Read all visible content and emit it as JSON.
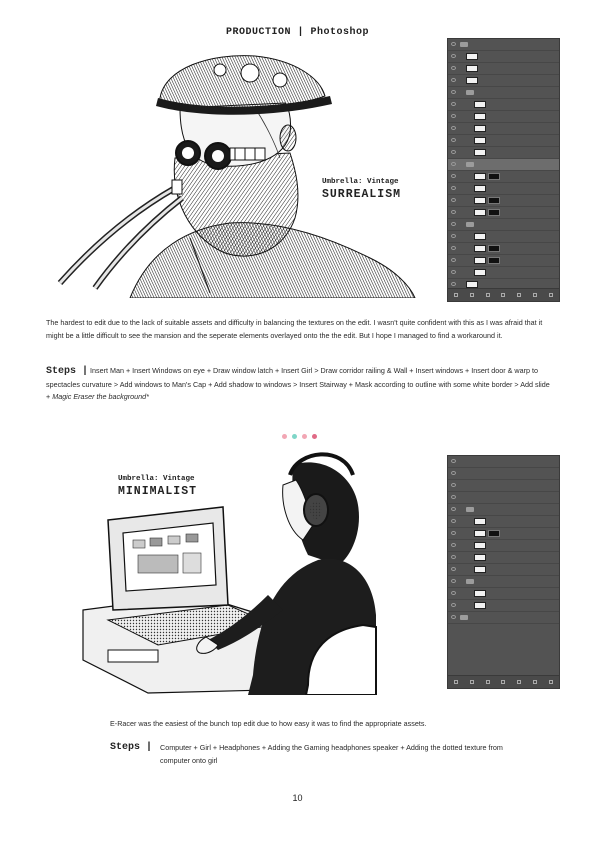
{
  "header": "PRODUCTION  |  Photoshop",
  "section1": {
    "umbrella_small": "Umbrella: Vintage",
    "umbrella_big": "SURREALISM",
    "description": "The hardest to edit due to the lack of suitable assets and difficulty in balancing the textures on the edit. I wasn't quite confident with this as I was afraid that it might be a little difficult to see the mansion and the seperate elements overlayed onto the the edit. But I hope I managed to find a workaround it.",
    "steps_label": "Steps  |",
    "steps_text": "Insert Man + Insert Windows on eye + Draw window latch + Insert Girl > Draw corridor railing & Wall + Insert windows + Insert door & warp to spectacles curvature > Add windows to Man's Cap + Add shadow to windows > Insert Stairway + Mask according to outline with some white border > Add slide + ",
    "steps_italic": "Magic Eraser the background*"
  },
  "divider": {
    "colors": [
      "#f2a6b4",
      "#7fd6c8",
      "#f2a6b4",
      "#e06a86"
    ]
  },
  "section2": {
    "umbrella_small": "Umbrella: Vintage",
    "umbrella_big": "MINIMALIST",
    "description": "E-Racer was the easiest of the bunch top edit due to how easy it was to find the appropriate assets.",
    "steps_label": "Steps  |",
    "steps_text": "Computer + Girl + Headphones + Adding the Gaming headphones speaker + Adding the dotted texture from computer onto girl"
  },
  "page_number": "10"
}
